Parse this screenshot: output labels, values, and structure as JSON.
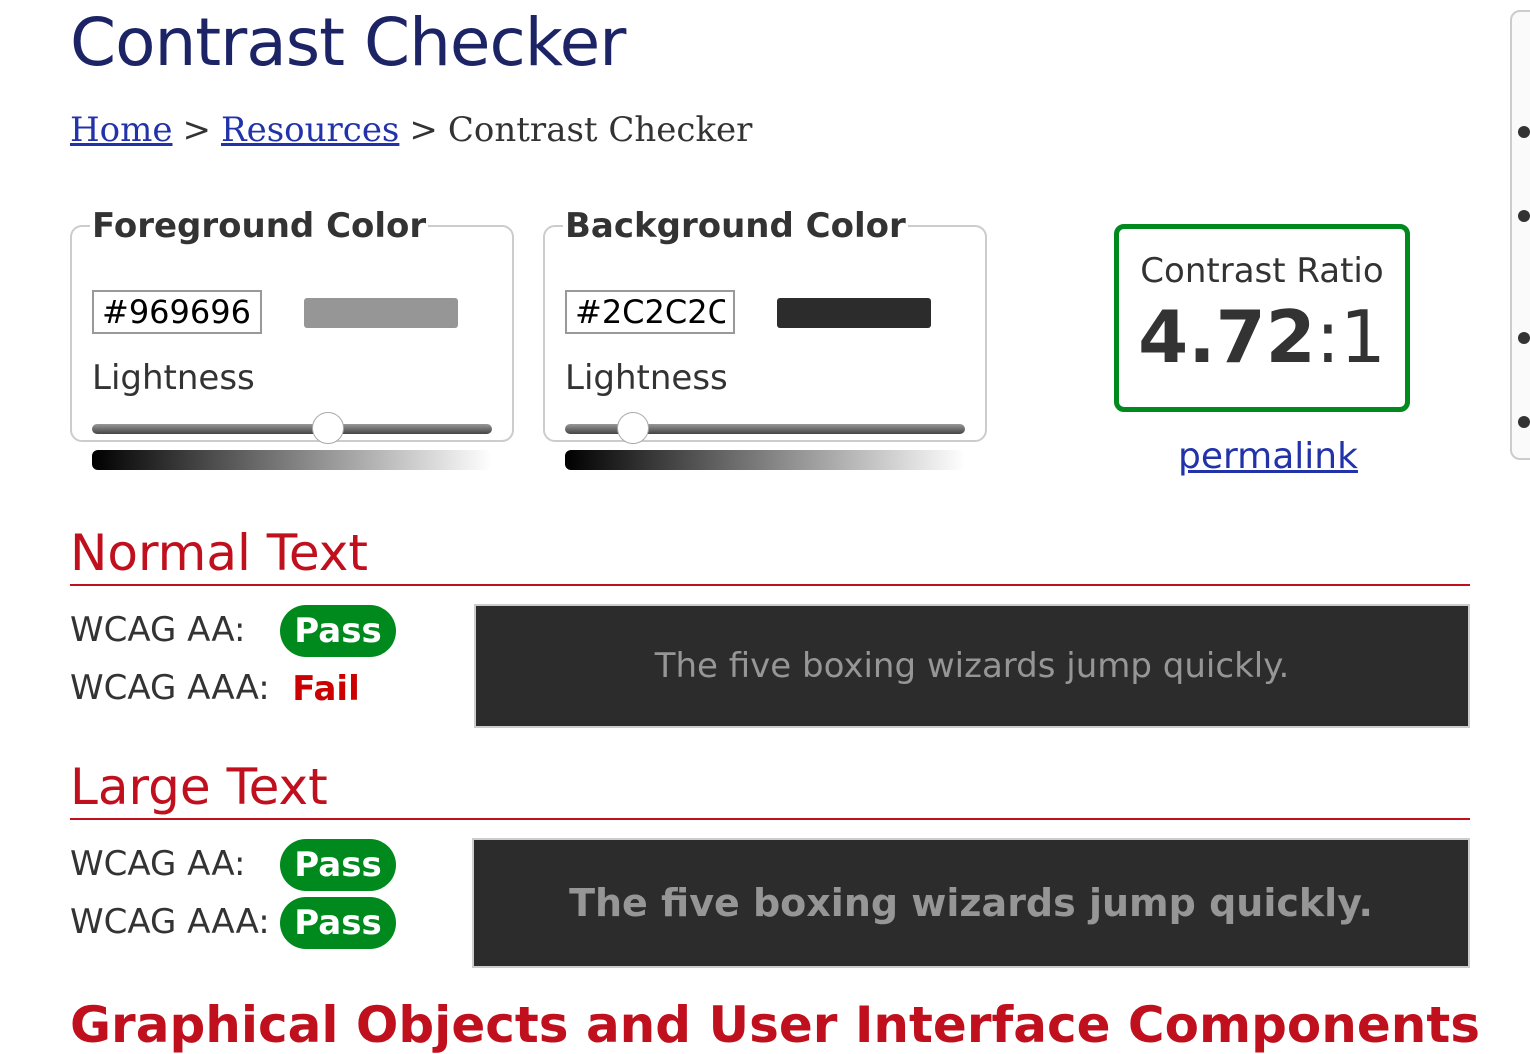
{
  "page": {
    "title": "Contrast Checker"
  },
  "breadcrumb": {
    "home": "Home",
    "resources": "Resources",
    "current": "Contrast Checker",
    "separator": ">"
  },
  "foreground": {
    "legend": "Foreground Color",
    "hex": "#969696",
    "color": "#969696",
    "lightness_label": "Lightness",
    "lightness_percent": 59
  },
  "background": {
    "legend": "Background Color",
    "hex": "#2C2C2C",
    "color": "#2C2C2C",
    "lightness_label": "Lightness",
    "lightness_percent": 17
  },
  "ratio": {
    "label": "Contrast Ratio",
    "value": "4.72",
    "suffix": ":1",
    "border_color": "#008a1e"
  },
  "permalink": "permalink",
  "normal": {
    "heading": "Normal Text",
    "aa_label": "WCAG AA:",
    "aa_result": "Pass",
    "aaa_label": "WCAG AAA:",
    "aaa_result": "Fail",
    "sample": "The five boxing wizards jump quickly."
  },
  "large": {
    "heading": "Large Text",
    "aa_label": "WCAG AA:",
    "aa_result": "Pass",
    "aaa_label": "WCAG AAA:",
    "aaa_result": "Pass",
    "sample": "The five boxing wizards jump quickly."
  },
  "next_heading": "Graphical Objects and User Interface Components",
  "colors": {
    "pass": "#008a1e",
    "fail": "#cc0000",
    "heading": "#c0101e",
    "title": "#1c2466",
    "link": "#2233aa"
  }
}
